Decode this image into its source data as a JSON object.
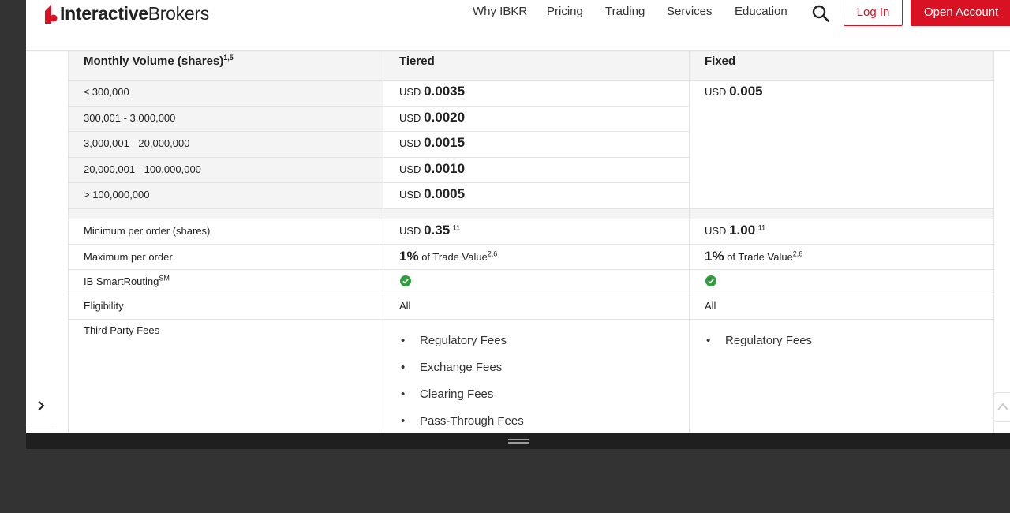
{
  "brand": {
    "name_bold": "Interactive",
    "name_light": "Brokers",
    "color": "#d81222"
  },
  "nav": {
    "items": [
      "Why IBKR",
      "Pricing",
      "Trading",
      "Services",
      "Education"
    ],
    "search_icon": "search-icon",
    "login_label": "Log In",
    "open_account_label": "Open Account"
  },
  "table": {
    "headers": {
      "volume": "Monthly Volume (shares)",
      "volume_sup": "1,5",
      "tiered": "Tiered",
      "fixed": "Fixed"
    },
    "tiers": [
      {
        "range": "≤ 300,000",
        "currency": "USD",
        "rate": "0.0035"
      },
      {
        "range": "300,001 - 3,000,000",
        "currency": "USD",
        "rate": "0.0020"
      },
      {
        "range": "3,000,001 - 20,000,000",
        "currency": "USD",
        "rate": "0.0015"
      },
      {
        "range": "20,000,001 - 100,000,000",
        "currency": "USD",
        "rate": "0.0010"
      },
      {
        "range": "> 100,000,000",
        "currency": "USD",
        "rate": "0.0005"
      }
    ],
    "fixed_rate": {
      "currency": "USD",
      "rate": "0.005"
    },
    "minimum": {
      "label": "Minimum per order (shares)",
      "tiered_currency": "USD",
      "tiered_value": "0.35",
      "tiered_sup": "11",
      "fixed_currency": "USD",
      "fixed_value": "1.00",
      "fixed_sup": "11"
    },
    "maximum": {
      "label": "Maximum per order",
      "tiered_pct": "1%",
      "tiered_text": "of Trade Value",
      "tiered_sup": "2,6",
      "fixed_pct": "1%",
      "fixed_text": "of Trade Value",
      "fixed_sup": "2,6"
    },
    "smartrouting": {
      "label": "IB SmartRouting",
      "sup": "SM",
      "tiered_icon": "check-circle-icon",
      "fixed_icon": "check-circle-icon"
    },
    "eligibility": {
      "label": "Eligibility",
      "tiered": "All",
      "fixed": "All"
    },
    "third_party": {
      "label": "Third Party Fees",
      "tiered": [
        "Regulatory Fees",
        "Exchange Fees",
        "Clearing Fees",
        "Pass-Through Fees"
      ],
      "fixed": [
        "Regulatory Fees"
      ]
    }
  },
  "colors": {
    "row_stripe": "#f4f4f4",
    "border": "#e3e3e3",
    "check": "#2e9d3e",
    "dark_bg": "#333333"
  }
}
